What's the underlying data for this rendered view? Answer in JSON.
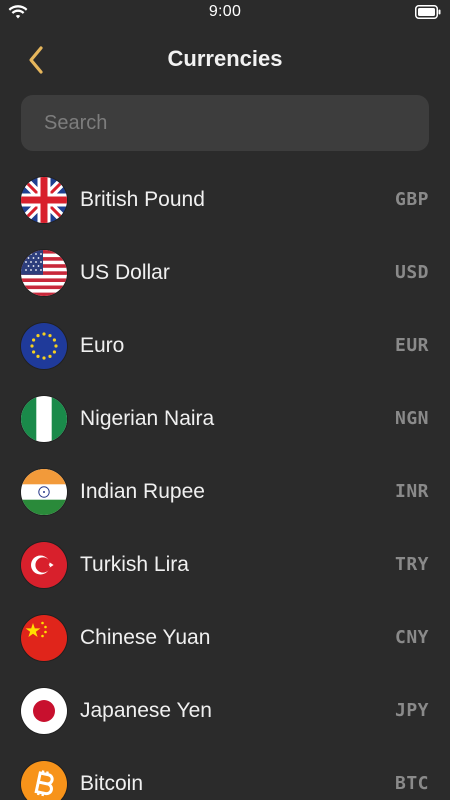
{
  "status_bar": {
    "time": "9:00",
    "icons": [
      "wifi-icon",
      "battery-icon"
    ]
  },
  "header": {
    "title": "Currencies",
    "back_icon": "chevron-left-icon",
    "accent_color": "#e6b65c"
  },
  "search": {
    "placeholder": "Search",
    "value": ""
  },
  "currencies": [
    {
      "name": "British Pound",
      "code": "GBP",
      "icon": "uk-flag-icon"
    },
    {
      "name": "US Dollar",
      "code": "USD",
      "icon": "us-flag-icon"
    },
    {
      "name": "Euro",
      "code": "EUR",
      "icon": "eu-flag-icon"
    },
    {
      "name": "Nigerian Naira",
      "code": "NGN",
      "icon": "nigeria-flag-icon"
    },
    {
      "name": "Indian Rupee",
      "code": "INR",
      "icon": "india-flag-icon"
    },
    {
      "name": "Turkish Lira",
      "code": "TRY",
      "icon": "turkey-flag-icon"
    },
    {
      "name": "Chinese Yuan",
      "code": "CNY",
      "icon": "china-flag-icon"
    },
    {
      "name": "Japanese Yen",
      "code": "JPY",
      "icon": "japan-flag-icon"
    },
    {
      "name": "Bitcoin",
      "code": "BTC",
      "icon": "bitcoin-icon"
    }
  ]
}
